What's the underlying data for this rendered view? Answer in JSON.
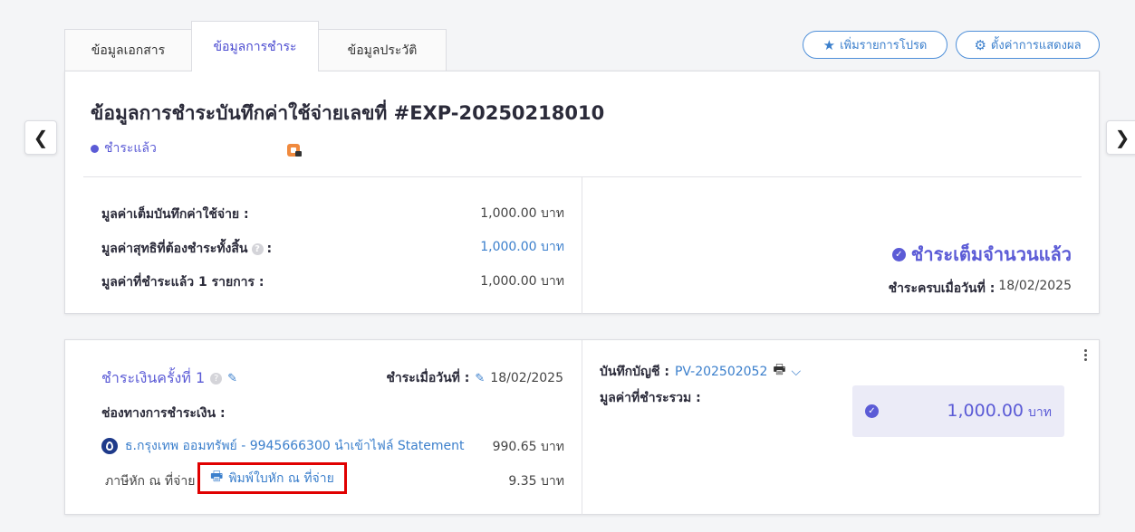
{
  "tabs": [
    {
      "label": "ข้อมูลเอกสาร"
    },
    {
      "label": "ข้อมูลการชำระ"
    },
    {
      "label": "ข้อมูลประวัติ"
    }
  ],
  "toolbar": {
    "favorite_label": "เพิ่มรายการโปรด",
    "display_settings_label": "ตั้งค่าการแสดงผล"
  },
  "header": {
    "title": "ข้อมูลการชำระบันทึกค่าใช้จ่ายเลขที่ #EXP-20250218010",
    "status": "ชำระแล้ว"
  },
  "summary": {
    "rows": [
      {
        "label": "มูลค่าเต็มบันทึกค่าใช้จ่าย :",
        "value": "1,000.00 บาท"
      },
      {
        "label": "มูลค่าสุทธิที่ต้องชำระทั้งสิ้น",
        "suffix": ":",
        "value": "1,000.00 บาท"
      },
      {
        "label": "มูลค่าที่ชำระแล้ว 1 รายการ :",
        "value": "1,000.00 บาท"
      }
    ],
    "paid_status": "ชำระเต็มจำนวนแล้ว",
    "paid_date_label": "ชำระครบเมื่อวันที่ :",
    "paid_date": "18/02/2025"
  },
  "payment": {
    "title": "ชำระเงินครั้งที่ 1",
    "date_label": "ชำระเมื่อวันที่ :",
    "date": "18/02/2025",
    "channel_label": "ช่องทางการชำระเงิน :",
    "channel_name": "ธ.กรุงเทพ ออมทรัพย์ - 9945666300 นำเข้าไฟล์ Statement",
    "channel_amount": "990.65 บาท",
    "wht_label": "ภาษีหัก ณ ที่จ่าย",
    "wht_print_label": "พิมพ์ใบหัก ณ ที่จ่าย",
    "wht_amount": "9.35 บาท",
    "journal_label": "บันทึกบัญชี :",
    "journal_ref": "PV-202502052",
    "total_label": "มูลค่าที่ชำระรวม :",
    "total_value": "1,000.00",
    "total_unit": "บาท"
  },
  "colors": {
    "accent": "#5b5bd6",
    "link": "#3b7fcc",
    "highlight_border": "#e00000",
    "total_bg": "#ebebf7"
  }
}
